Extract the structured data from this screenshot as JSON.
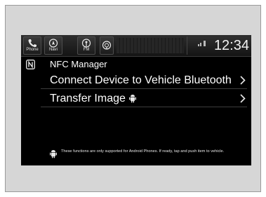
{
  "statusbar": {
    "buttons": [
      {
        "label": "Phone",
        "icon": "phone-icon"
      },
      {
        "label": "Navi",
        "icon": "navi-icon"
      },
      {
        "label": "FM",
        "icon": "radio-icon"
      },
      {
        "label": "",
        "icon": "siri-eyes-icon"
      }
    ],
    "clock": "12:34",
    "indicators": [
      "signal-icon",
      "battery-icon"
    ]
  },
  "header": {
    "icon": "nfc-icon",
    "title": "NFC Manager"
  },
  "menu": {
    "items": [
      {
        "label": "Connect Device to Vehicle Bluetooth",
        "icon": "chevron-right-icon"
      },
      {
        "label": "Transfer Image",
        "badge_icon": "android-icon",
        "icon": "chevron-right-icon"
      }
    ]
  },
  "footer": {
    "icon": "android-icon",
    "note": "These functions are only supported for Android Phones. If ready, tap and push item to vehicle."
  },
  "colors": {
    "background": "#000000",
    "frame": "#d6d6d6",
    "text": "#ffffff"
  }
}
